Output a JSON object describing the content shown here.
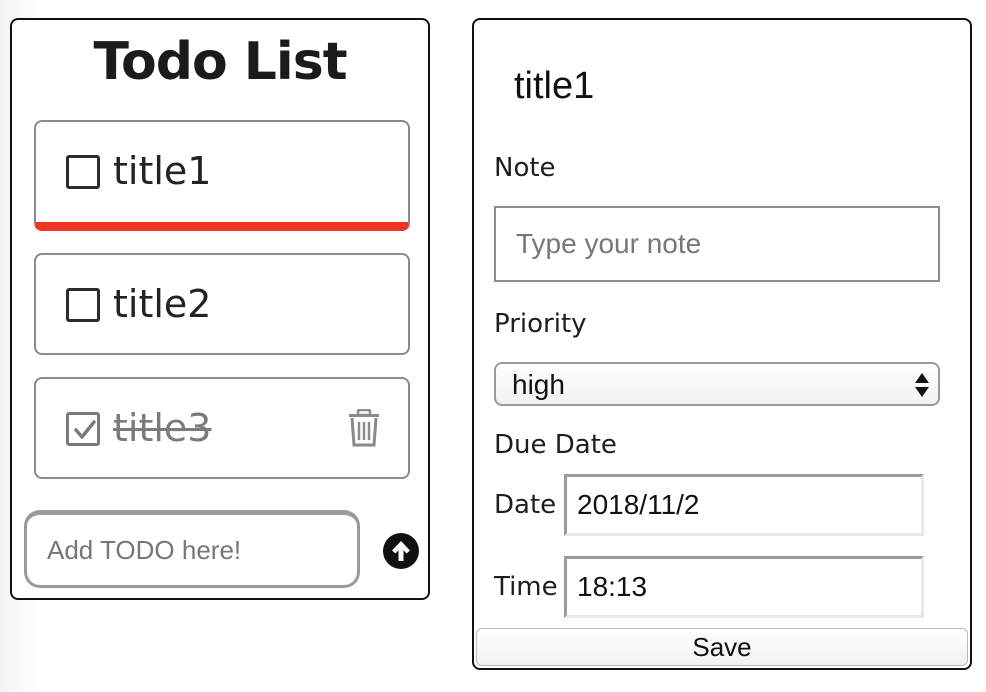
{
  "todo_panel": {
    "title": "Todo List",
    "items": [
      {
        "label": "title1",
        "checked": false,
        "selected": true
      },
      {
        "label": "title2",
        "checked": false,
        "selected": false
      },
      {
        "label": "title3",
        "checked": true,
        "selected": false
      }
    ],
    "add_input": {
      "placeholder": "Add TODO here!",
      "value": ""
    },
    "accent_color": "#ee3524"
  },
  "detail_panel": {
    "title": "title1",
    "note_label": "Note",
    "note_placeholder": "Type your note",
    "note_value": "",
    "priority_label": "Priority",
    "priority_value": "high",
    "due_date_label": "Due Date",
    "date_label": "Date",
    "date_value": "2018/11/2",
    "time_label": "Time",
    "time_value": "18:13",
    "save_label": "Save"
  },
  "icons": [
    "checkbox-icon",
    "checked-checkbox-icon",
    "trash-icon",
    "arrow-up-circle-icon",
    "select-arrows-icon"
  ]
}
